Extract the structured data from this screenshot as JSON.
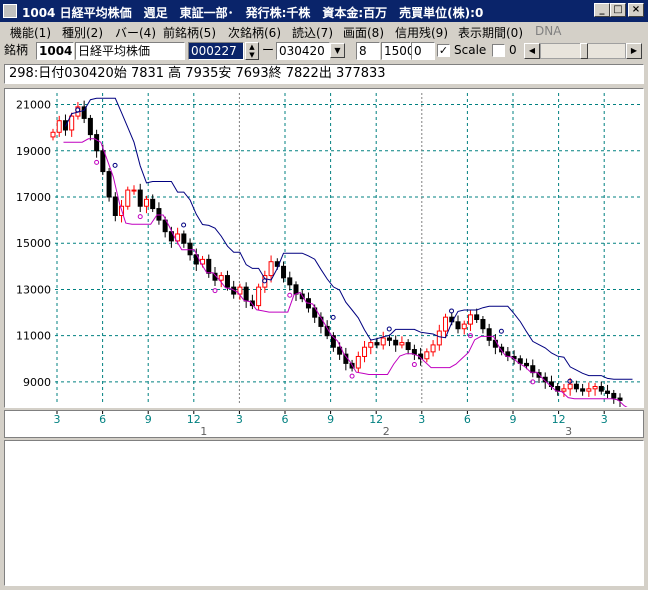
{
  "window": {
    "title": "1004 日経平均株価　週足　東証一部･　発行株:千株　資本金:百万　売買単位(株):0",
    "min_label": "_",
    "max_label": "□",
    "close_label": "×"
  },
  "menu": [
    {
      "label": "機能(1)",
      "enabled": true
    },
    {
      "label": "種別(2)",
      "enabled": true
    },
    {
      "label": "バー(4)",
      "enabled": true
    },
    {
      "label": "前銘柄(5)",
      "enabled": true
    },
    {
      "label": "次銘柄(6)",
      "enabled": true
    },
    {
      "label": "読込(7)",
      "enabled": true
    },
    {
      "label": "画面(8)",
      "enabled": true
    },
    {
      "label": "信用残(9)",
      "enabled": true
    },
    {
      "label": "表示期間(0)",
      "enabled": true
    },
    {
      "label": "DNA",
      "enabled": false
    }
  ],
  "toolbar": {
    "ticker_label": "銘柄",
    "ticker_code": "1004",
    "ticker_name": "日経平均株価",
    "start_value": "000227",
    "dash": "ー",
    "end_value": "030420",
    "param1": "8",
    "param2": "1500",
    "param3": "0",
    "scale_checked": true,
    "scale_label": "Scale",
    "scale_value": "0",
    "scroll_left": "◀",
    "scroll_right": "▶",
    "spin_up": "▲",
    "spin_down": "▼",
    "drop_arrow": "▼"
  },
  "infobar": {
    "text": "298:日付030420始 7831 高 7935安 7693終 7822出 377833"
  },
  "colors": {
    "grid": "#008080",
    "up_candle": "#ff0000",
    "down_candle": "#000000",
    "resistance": "#000080",
    "support": "#c000c0",
    "axis_text": "#008080"
  },
  "chart_data": {
    "type": "candlestick",
    "title": "",
    "ylabel": "",
    "y_ticks": [
      "21000",
      "19000",
      "17000",
      "15000",
      "13000",
      "11000",
      "9000"
    ],
    "ylim": [
      8000,
      21500
    ],
    "x_month_ticks": [
      "3",
      "6",
      "9",
      "12",
      "3",
      "6",
      "9",
      "12",
      "3",
      "6",
      "9",
      "12",
      "3"
    ],
    "x_year_labels": [
      "1",
      "2",
      "3"
    ],
    "series": [
      {
        "name": "",
        "values": [
          19800,
          20300,
          19900,
          20500,
          20900,
          20400,
          19700,
          19000,
          18100,
          17000,
          16200,
          16600,
          17300,
          17300,
          16600,
          16900,
          16500,
          16000,
          15500,
          15100,
          15400,
          15000,
          14500,
          14100,
          14300,
          13700,
          13400,
          13600,
          13100,
          12800,
          13100,
          12500,
          12300,
          13100,
          13600,
          14200,
          14000,
          13500,
          13200,
          12800,
          12600,
          12200,
          11800,
          11400,
          11000,
          10500,
          10200,
          9800,
          9600,
          10100,
          10500,
          10700,
          10600,
          10900,
          10800,
          10600,
          10700,
          10400,
          10200,
          10000,
          10300,
          10600,
          11200,
          11800,
          11600,
          11300,
          11500,
          11900,
          11700,
          11300,
          10800,
          10500,
          10300,
          10100,
          10000,
          9800,
          9700,
          9400,
          9200,
          9000,
          8800,
          8600,
          8700,
          8900,
          8700,
          8600,
          8700,
          8800,
          8600,
          8500,
          8300,
          8200
        ]
      }
    ]
  }
}
